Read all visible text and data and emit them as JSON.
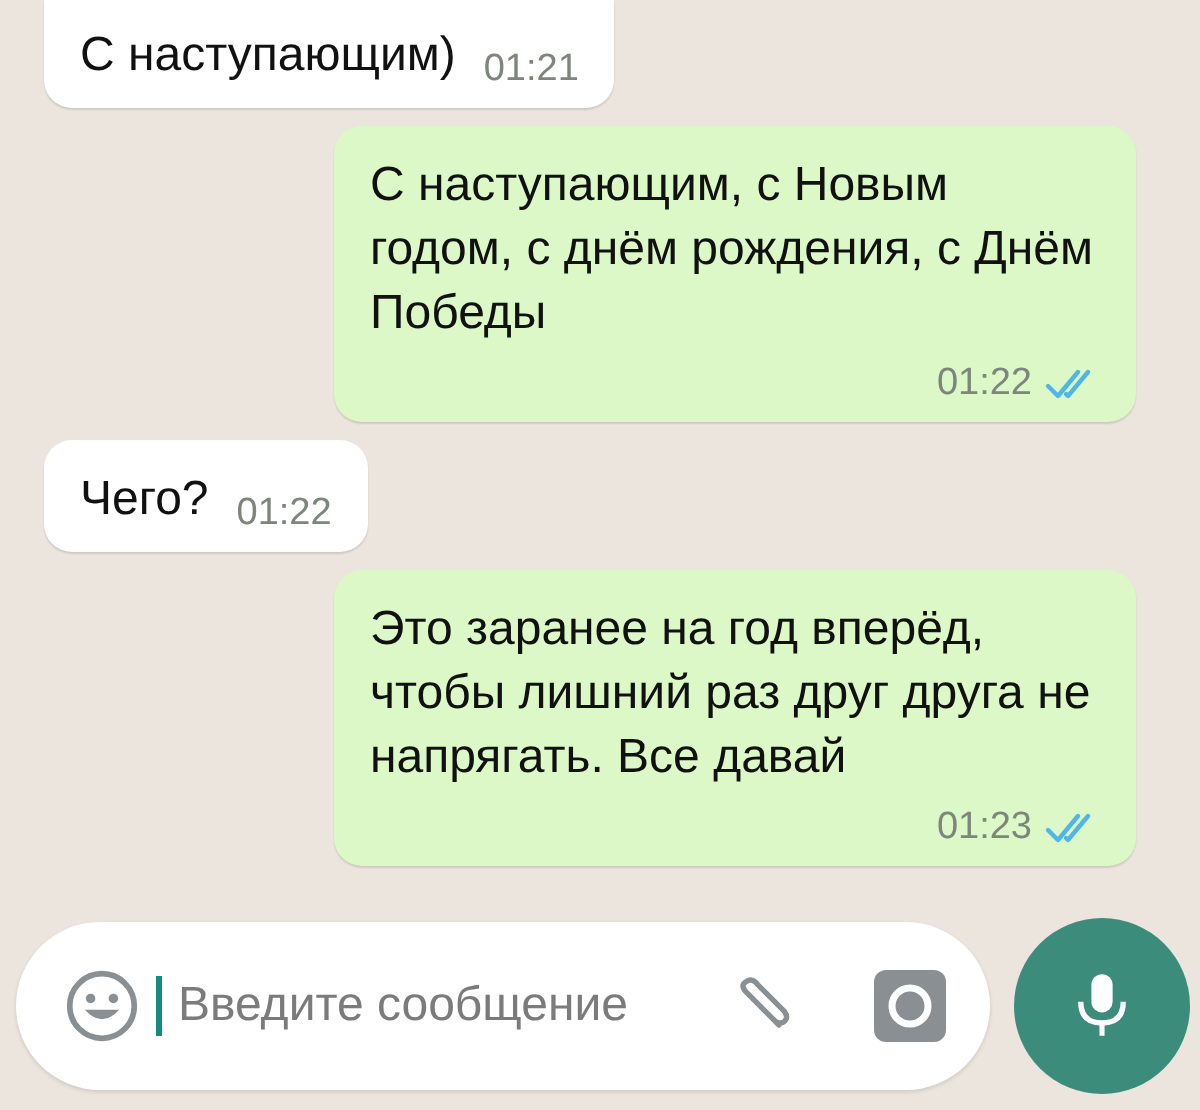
{
  "messages": [
    {
      "kind": "incoming",
      "text": "С наступающим)",
      "time": "01:21"
    },
    {
      "kind": "outgoing",
      "text": "С наступающим, с Новым годом, с днём рождения, с Днём Победы",
      "time": "01:22",
      "read": true
    },
    {
      "kind": "incoming",
      "text": "Чего?",
      "time": "01:22"
    },
    {
      "kind": "outgoing",
      "text": "Это заранее на год вперёд, чтобы лишний раз друг друга не напрягать. Все давай",
      "time": "01:23",
      "read": true
    }
  ],
  "composer": {
    "placeholder": "Введите сообщение"
  }
}
